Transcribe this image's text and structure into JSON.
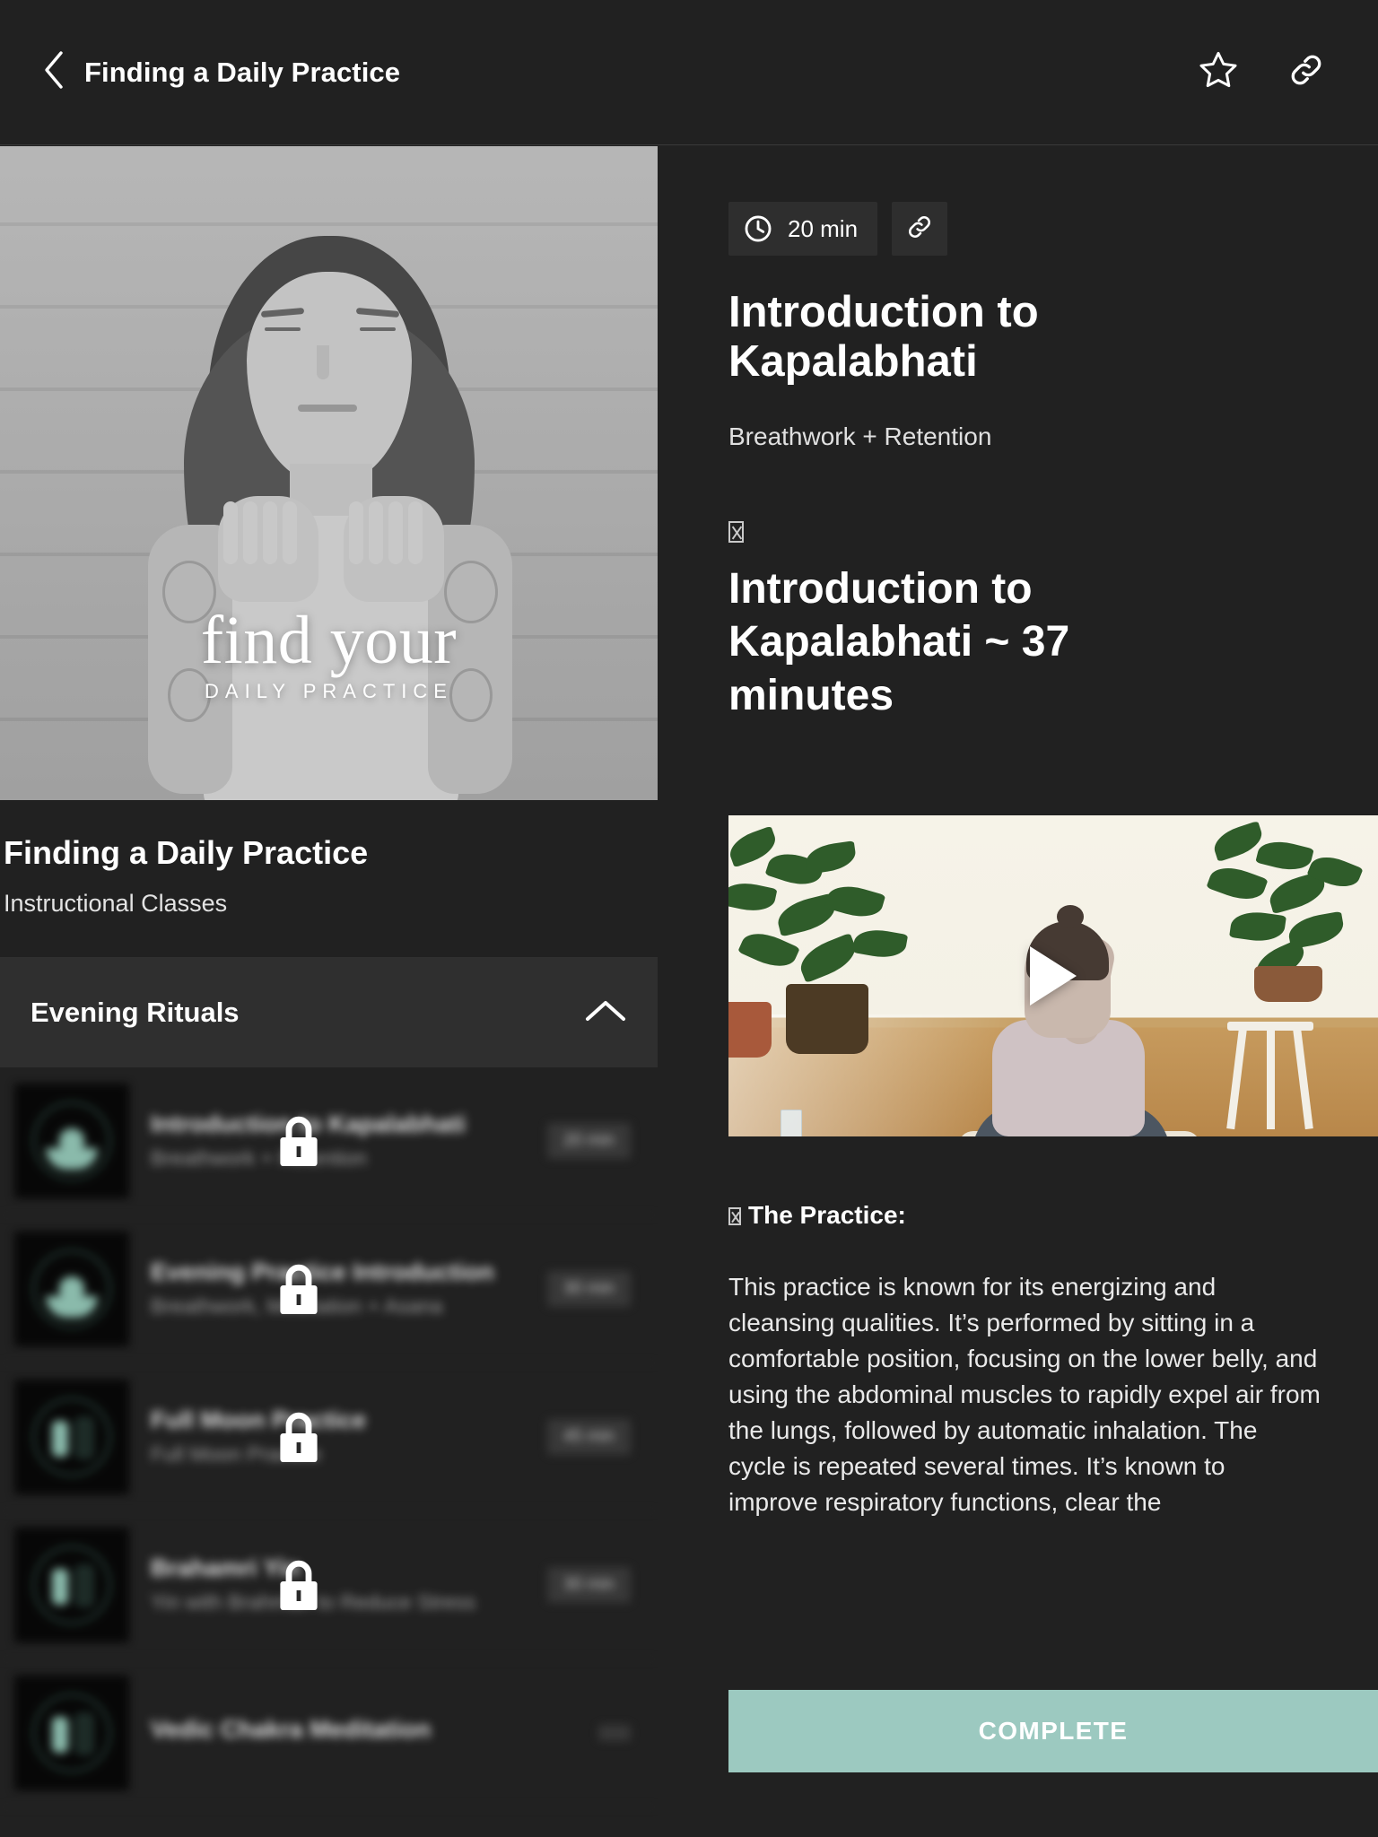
{
  "topbar": {
    "back_icon": "chevron-left-icon",
    "title": "Finding a Daily Practice",
    "favorite_icon": "star-icon",
    "share_icon": "link-icon"
  },
  "left": {
    "hero": {
      "logo_text": "find your",
      "logo_subtext": "DAILY PRACTICE"
    },
    "course_title": "Finding a Daily Practice",
    "course_subtitle": "Instructional Classes",
    "section": {
      "title": "Evening Rituals",
      "chevron_icon": "chevron-up-icon",
      "expanded": true
    },
    "lessons": [
      {
        "name": "Introduction to Kapalabhati",
        "desc": "Breathwork + Retention",
        "duration": "20 min",
        "locked": true,
        "thumb_icon": "lotus-meditation-icon"
      },
      {
        "name": "Evening Practice Introduction",
        "desc": "Breathwork, Meditation + Asana",
        "duration": "30 min",
        "locked": true,
        "thumb_icon": "lotus-meditation-icon"
      },
      {
        "name": "Full Moon Practice",
        "desc": "Full Moon Practice",
        "duration": "45 min",
        "locked": true,
        "thumb_icon": "moon-icon"
      },
      {
        "name": "Brahamri Yin",
        "desc": "Yin with Brahmari to Reduce Stress",
        "duration": "30 min",
        "locked": true,
        "thumb_icon": "moon-icon"
      },
      {
        "name": "Vedic Chakra Meditation",
        "desc": "",
        "duration": "",
        "locked": true,
        "thumb_icon": "moon-icon"
      }
    ]
  },
  "right": {
    "duration_badge": {
      "clock_icon": "clock-icon",
      "text": "20 min"
    },
    "share_icon": "link-icon",
    "lesson_title": "Introduction to Kapalabhati",
    "lesson_category": "Breathwork + Retention",
    "content_heading_icon": "missing-glyph-box",
    "content_heading": "Introduction to Kapalabhati ~ 37 minutes",
    "video": {
      "play_icon": "play-icon"
    },
    "practice_label": "The Practice:",
    "practice_label_icon": "missing-glyph-box",
    "practice_body": "This practice is known for its energizing and cleansing qualities. It’s performed by sitting in a comfortable position, focusing on the lower belly, and using the abdominal muscles to rapidly expel air from the lungs, followed by automatic inhalation. The cycle is repeated several times. It’s known to improve respiratory functions, clear the",
    "complete_button": "COMPLETE"
  },
  "colors": {
    "background": "#212121",
    "panel": "#2f2f2f",
    "accent": "#9cc9c0",
    "text": "#ffffff"
  }
}
